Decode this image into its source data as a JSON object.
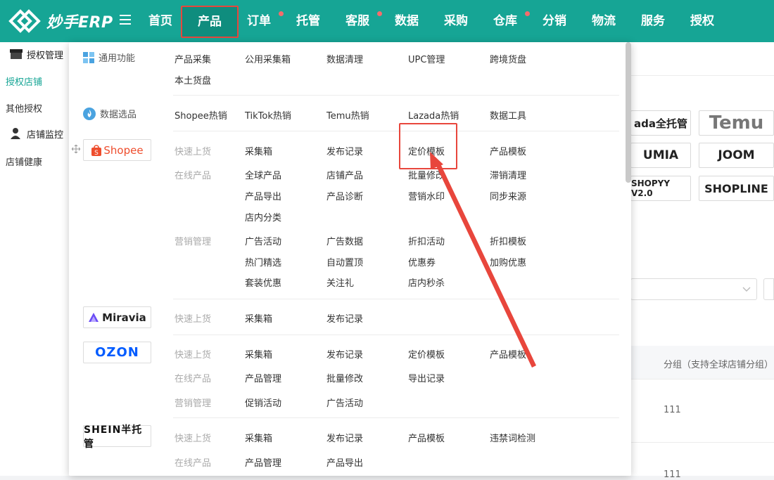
{
  "header": {
    "logo_text": "妙手ERP",
    "nav": [
      {
        "label": "首页",
        "dot": false
      },
      {
        "label": "产品",
        "dot": false,
        "active": true
      },
      {
        "label": "订单",
        "dot": true
      },
      {
        "label": "托管",
        "dot": false
      },
      {
        "label": "客服",
        "dot": true
      },
      {
        "label": "数据",
        "dot": false
      },
      {
        "label": "采购",
        "dot": false
      },
      {
        "label": "仓库",
        "dot": true
      },
      {
        "label": "分销",
        "dot": false
      },
      {
        "label": "物流",
        "dot": false
      },
      {
        "label": "服务",
        "dot": false
      },
      {
        "label": "授权",
        "dot": false
      }
    ]
  },
  "sidebar": {
    "section1": "授权管理",
    "links1": [
      "授权店铺",
      "其他授权"
    ],
    "section2": "店铺监控",
    "links2": [
      "店铺健康"
    ]
  },
  "main": {
    "platforms": [
      "ada全托管",
      "Temu",
      "UMIA",
      "JOOM",
      "SHOPYY V2.0",
      "SHOPLINE"
    ],
    "column_header": "分组（支持全球店铺分组）",
    "cells": [
      "111",
      "111"
    ]
  },
  "mega": {
    "general": {
      "title": "通用功能",
      "items": [
        "产品采集",
        "公用采集箱",
        "数据清理",
        "UPC管理",
        "跨境货盘",
        "本土货盘"
      ]
    },
    "data_select": {
      "title": "数据选品",
      "items": [
        "Shopee热销",
        "TikTok热销",
        "Temu热销",
        "Lazada热销",
        "数据工具"
      ]
    },
    "shopee": {
      "logo": "Shopee",
      "quick_label": "快速上货",
      "quick": [
        "采集箱",
        "发布记录",
        "定价模板",
        "产品模板"
      ],
      "online_label": "在线产品",
      "online": [
        "全球产品",
        "店铺产品",
        "批量修改",
        "滞销清理",
        "产品导出",
        "产品诊断",
        "营销水印",
        "同步来源",
        "店内分类"
      ],
      "marketing_label": "营销管理",
      "marketing": [
        "广告活动",
        "广告数据",
        "折扣活动",
        "折扣模板",
        "热门精选",
        "自动置顶",
        "优惠券",
        "加购优惠",
        "套装优惠",
        "关注礼",
        "店内秒杀"
      ]
    },
    "miravia": {
      "logo": "Miravia",
      "quick_label": "快速上货",
      "quick": [
        "采集箱",
        "发布记录"
      ]
    },
    "ozon": {
      "logo": "OZON",
      "quick_label": "快速上货",
      "quick": [
        "采集箱",
        "发布记录",
        "定价模板",
        "产品模板"
      ],
      "online_label": "在线产品",
      "online": [
        "产品管理",
        "批量修改",
        "导出记录"
      ],
      "marketing_label": "营销管理",
      "marketing": [
        "促销活动",
        "广告活动"
      ]
    },
    "shein": {
      "logo": "SHEIN半托管",
      "quick_label": "快速上货",
      "quick": [
        "采集箱",
        "发布记录",
        "产品模板",
        "违禁词检测"
      ],
      "online_label": "在线产品",
      "online": [
        "产品管理",
        "产品导出"
      ]
    }
  },
  "colors": {
    "brand": "#16a595",
    "highlight": "#e8463c",
    "shopee": "#ee4d2d",
    "ozon": "#005bff"
  }
}
